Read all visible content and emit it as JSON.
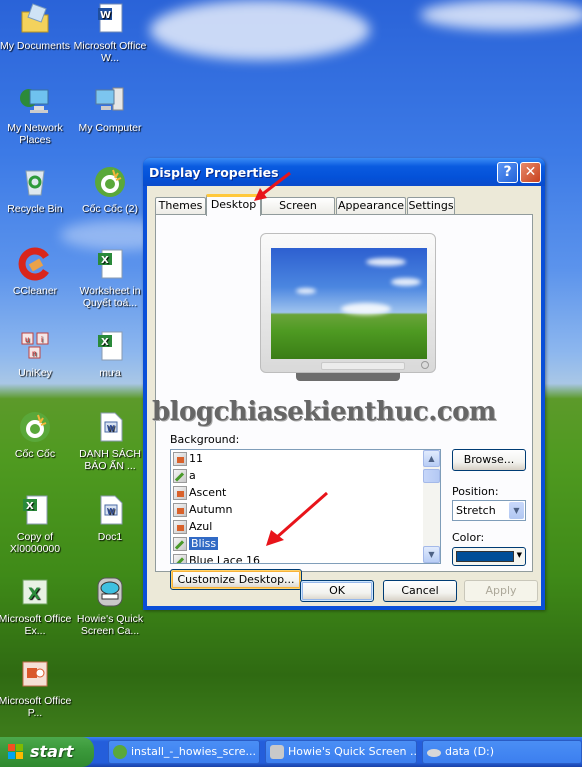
{
  "desktop": {
    "icons": [
      {
        "label": "My Documents",
        "icon": "folder-documents-icon"
      },
      {
        "label": "Microsoft Office W...",
        "icon": "word-icon"
      },
      {
        "label": "My Network Places",
        "icon": "network-places-icon"
      },
      {
        "label": "My Computer",
        "icon": "my-computer-icon"
      },
      {
        "label": "Recycle Bin",
        "icon": "recycle-bin-icon"
      },
      {
        "label": "Cốc Cốc (2)",
        "icon": "coccoc-icon"
      },
      {
        "label": "CCleaner",
        "icon": "ccleaner-icon"
      },
      {
        "label": "Worksheet in Quyết toá...",
        "icon": "excel-doc-icon"
      },
      {
        "label": "UniKey",
        "icon": "unikey-icon"
      },
      {
        "label": "mưa",
        "icon": "excel-doc-icon"
      },
      {
        "label": "Cốc Cốc",
        "icon": "coccoc-icon"
      },
      {
        "label": "DANH SÁCH BÁO ẤN ...",
        "icon": "word-doc-icon"
      },
      {
        "label": "Copy of Xl0000000",
        "icon": "excel-doc-icon"
      },
      {
        "label": "Doc1",
        "icon": "word-doc-icon"
      },
      {
        "label": "Microsoft Office Ex...",
        "icon": "excel-icon"
      },
      {
        "label": "Howie's Quick Screen Ca...",
        "icon": "howies-screen-capture-icon"
      },
      {
        "label": "Microsoft Office P...",
        "icon": "powerpoint-icon"
      }
    ]
  },
  "dialog": {
    "title": "Display Properties",
    "help_label": "?",
    "close_label": "✕",
    "tabs": [
      {
        "label": "Themes",
        "active": false
      },
      {
        "label": "Desktop",
        "active": true
      },
      {
        "label": "Screen Saver",
        "active": false
      },
      {
        "label": "Appearance",
        "active": false
      },
      {
        "label": "Settings",
        "active": false
      }
    ],
    "background_label": "Background:",
    "background_items": [
      {
        "label": "11",
        "type": "html"
      },
      {
        "label": "a",
        "type": "picture"
      },
      {
        "label": "Ascent",
        "type": "html"
      },
      {
        "label": "Autumn",
        "type": "html"
      },
      {
        "label": "Azul",
        "type": "html"
      },
      {
        "label": "Bliss",
        "type": "picture",
        "selected": true
      },
      {
        "label": "Blue Lace 16",
        "type": "picture"
      }
    ],
    "browse_label": "Browse...",
    "position_label": "Position:",
    "position_value": "Stretch",
    "color_label": "Color:",
    "color_value": "#004e98",
    "customize_label": "Customize Desktop...",
    "ok_label": "OK",
    "cancel_label": "Cancel",
    "apply_label": "Apply"
  },
  "watermark": "blogchiasekienthuc.com",
  "taskbar": {
    "start_label": "start",
    "tasks": [
      {
        "label": "install_-_howies_scre..."
      },
      {
        "label": "Howie's Quick Screen ..."
      },
      {
        "label": "data (D:)"
      }
    ]
  }
}
